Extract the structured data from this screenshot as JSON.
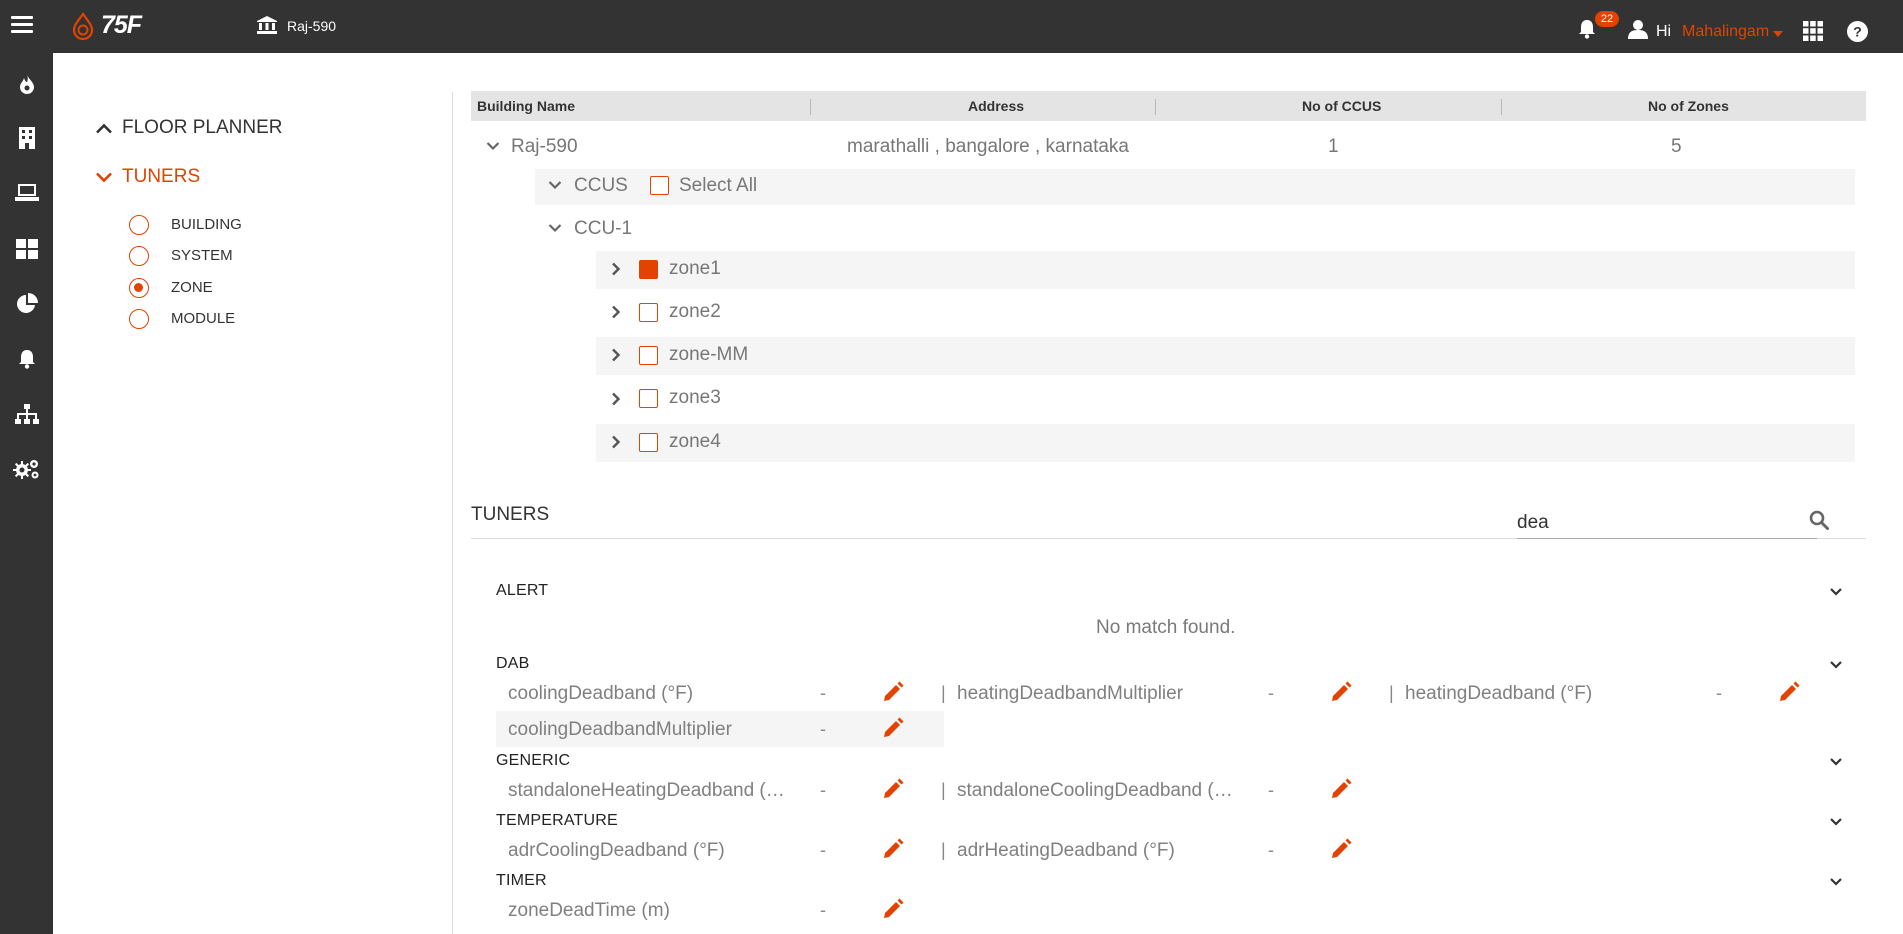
{
  "header": {
    "logo_text": "75F",
    "site_name": "Raj-590",
    "notification_count": "22",
    "greeting": "Hi",
    "user_name": "Mahalingam"
  },
  "sidenav": {
    "icons": [
      "flame-icon",
      "building-icon",
      "laptop-icon",
      "dashboard-icon",
      "pie-chart-icon",
      "bell-icon",
      "sitemap-icon",
      "cogs-icon"
    ]
  },
  "left_menu": {
    "floor_planner": "FLOOR PLANNER",
    "tuners": "TUNERS",
    "levels": [
      {
        "label": "BUILDING",
        "selected": false
      },
      {
        "label": "SYSTEM",
        "selected": false
      },
      {
        "label": "ZONE",
        "selected": true
      },
      {
        "label": "MODULE",
        "selected": false
      }
    ]
  },
  "table": {
    "headers": [
      "Building Name",
      "Address",
      "No of CCUS",
      "No of Zones"
    ],
    "building": {
      "name": "Raj-590",
      "address": "marathalli , bangalore , karnataka",
      "ccus": "1",
      "zones": "5"
    },
    "ccus_label": "CCUS",
    "select_all": "Select All",
    "ccu_name": "CCU-1",
    "zones": [
      {
        "name": "zone1",
        "checked": true
      },
      {
        "name": "zone2",
        "checked": false
      },
      {
        "name": "zone-MM",
        "checked": false
      },
      {
        "name": "zone3",
        "checked": false
      },
      {
        "name": "zone4",
        "checked": false
      }
    ]
  },
  "tuners": {
    "title": "TUNERS",
    "search_value": "dea",
    "no_match": "No match found.",
    "sections": {
      "alert": "ALERT",
      "dab": "DAB",
      "generic": "GENERIC",
      "temperature": "TEMPERATURE",
      "timer": "TIMER"
    },
    "params": {
      "p1": {
        "name": "coolingDeadband (°F)",
        "value": "-"
      },
      "p2": {
        "name": "heatingDeadbandMultiplier",
        "value": "-"
      },
      "p3": {
        "name": "heatingDeadband (°F)",
        "value": "-"
      },
      "p4": {
        "name": "coolingDeadbandMultiplier",
        "value": "-"
      },
      "p5": {
        "name": "standaloneHeatingDeadband (…",
        "value": "-"
      },
      "p6": {
        "name": "standaloneCoolingDeadband (…",
        "value": "-"
      },
      "p7": {
        "name": "adrCoolingDeadband (°F)",
        "value": "-"
      },
      "p8": {
        "name": "adrHeatingDeadband (°F)",
        "value": "-"
      },
      "p9": {
        "name": "zoneDeadTime (m)",
        "value": "-"
      }
    },
    "separator": "|"
  },
  "colors": {
    "accent": "#E24301",
    "topbar": "#333333",
    "header_row": "#e4e4e4",
    "row_alt": "#f5f5f5"
  }
}
